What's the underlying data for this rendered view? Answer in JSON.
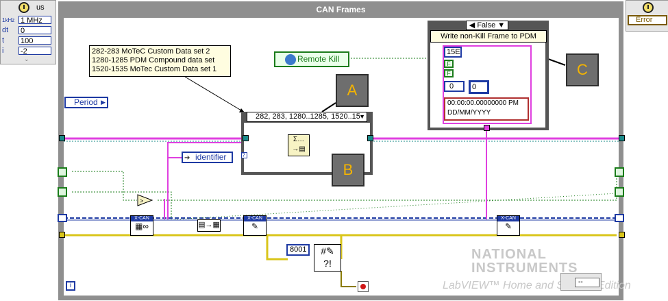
{
  "timing": {
    "source_label": "us",
    "rows": [
      {
        "term": "1kHz",
        "value": "1 MHz"
      },
      {
        "term": "dt",
        "value": "0"
      },
      {
        "term": "t",
        "value": "100"
      },
      {
        "term": "i",
        "value": "-2"
      }
    ]
  },
  "error_terminal": {
    "label": "Error"
  },
  "loop": {
    "title": "CAN Frames"
  },
  "period_label": "Period",
  "annotation": {
    "lines": [
      "282-283 MoTeC Custom Data set 2",
      "1280-1285 PDM Compound data set",
      "1520-1535 MoTec Custom Data set 1"
    ]
  },
  "case_selector": {
    "value": "282, 283, 1280..1285, 1520..15"
  },
  "remote_kill_label": "Remote Kill",
  "identifier_label": "identifier",
  "case_false": {
    "selector": "False",
    "caption": "Write non-Kill Frame to PDM",
    "hex_value": "15E",
    "bool1": "F",
    "bool2": "F",
    "num1": "0",
    "num2": "0",
    "timestamp": [
      "00:00:00.00000000 PM",
      "DD/MM/YYYY"
    ]
  },
  "callouts": {
    "a": "A",
    "b": "B",
    "c": "C"
  },
  "xcan_labels": [
    "X-CAN",
    "X-CAN",
    "X-CAN"
  ],
  "const_8001": "8001",
  "info_icon": "i",
  "watermark": {
    "line1": "NATIONAL",
    "line2": "INSTRUMENTS",
    "line3": "LabVIEW™ Home and Student Edition"
  },
  "status_box": "--",
  "colors": {
    "pink_wire": "#e040e0",
    "blue_wire": "#1e3aa3",
    "yellow_wire": "#d9c51a",
    "green_wire": "#1a7c1a",
    "teal": "#1b8a8a"
  }
}
